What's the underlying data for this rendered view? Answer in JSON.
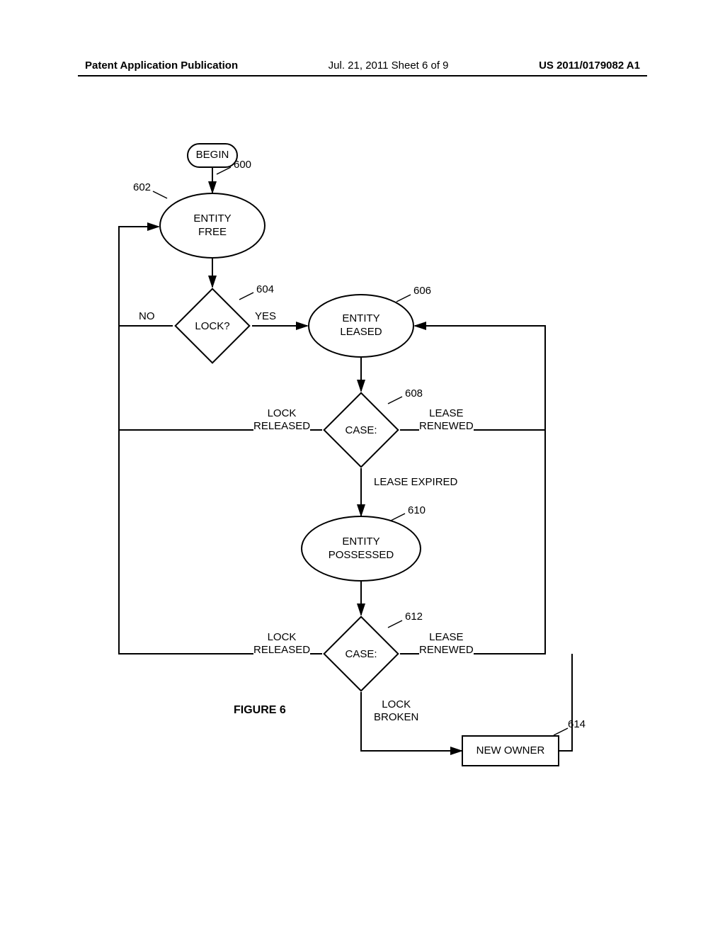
{
  "header": {
    "left": "Patent Application Publication",
    "center": "Jul. 21, 2011  Sheet 6 of 9",
    "right": "US 2011/0179082 A1"
  },
  "refs": {
    "r600": "600",
    "r602": "602",
    "r604": "604",
    "r606": "606",
    "r608": "608",
    "r610": "610",
    "r612": "612",
    "r614": "614"
  },
  "nodes": {
    "begin": "BEGIN",
    "entity_free": "ENTITY\nFREE",
    "lock_q": "LOCK?",
    "entity_leased": "ENTITY\nLEASED",
    "case1": "CASE:",
    "entity_possessed": "ENTITY\nPOSSESSED",
    "case2": "CASE:",
    "new_owner": "NEW OWNER"
  },
  "edges": {
    "no": "NO",
    "yes": "YES",
    "lock_released1": "LOCK\nRELEASED",
    "lease_renewed1": "LEASE\nRENEWED",
    "lease_expired": "LEASE EXPIRED",
    "lock_released2": "LOCK\nRELEASED",
    "lease_renewed2": "LEASE\nRENEWED",
    "lock_broken": "LOCK\nBROKEN"
  },
  "figure": "FIGURE 6"
}
